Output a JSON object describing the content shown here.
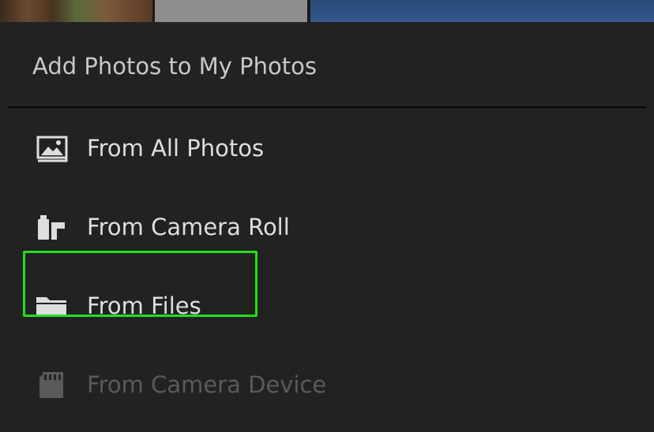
{
  "thumbnails": [
    {
      "name": "thumbnail-1"
    },
    {
      "name": "thumbnail-2"
    },
    {
      "name": "thumbnail-3"
    }
  ],
  "sheet": {
    "title": "Add Photos to My Photos",
    "items": [
      {
        "label": "From All Photos",
        "icon": "photo-library-icon",
        "enabled": true
      },
      {
        "label": "From Camera Roll",
        "icon": "camera-roll-icon",
        "enabled": true
      },
      {
        "label": "From Files",
        "icon": "folder-icon",
        "enabled": true,
        "highlighted": true
      },
      {
        "label": "From Camera Device",
        "icon": "sd-card-icon",
        "enabled": false
      }
    ]
  },
  "colors": {
    "background": "#222222",
    "text": "#dedede",
    "title": "#c8c8c8",
    "disabled_text": "#5a5a5a",
    "highlight": "#22e01a"
  }
}
